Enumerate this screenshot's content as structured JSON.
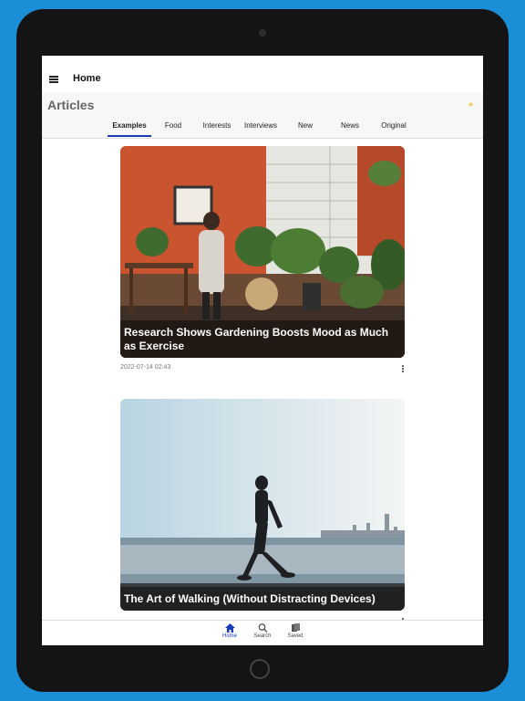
{
  "appbar": {
    "title": "Home",
    "menu_icon": "menu-icon"
  },
  "header": {
    "title": "Articles",
    "icon": "star-icon"
  },
  "tabs": [
    "Examples",
    "Food",
    "Interests",
    "Interviews",
    "New",
    "News",
    "Original"
  ],
  "active_tab": "Examples",
  "articles": [
    {
      "title": "Research Shows Gardening Boosts Mood as Much as Exercise",
      "date": "2022-07-14 02:43"
    },
    {
      "title": "The Art of Walking (Without Distracting Devices)",
      "date": ""
    }
  ],
  "bottom_nav": [
    {
      "label": "Home",
      "icon": "home-icon"
    },
    {
      "label": "Search",
      "icon": "search-icon"
    },
    {
      "label": "Saved",
      "icon": "bookmark-icon"
    }
  ],
  "colors": {
    "accent": "#1a3bb8",
    "background": "#1a8fd8"
  }
}
